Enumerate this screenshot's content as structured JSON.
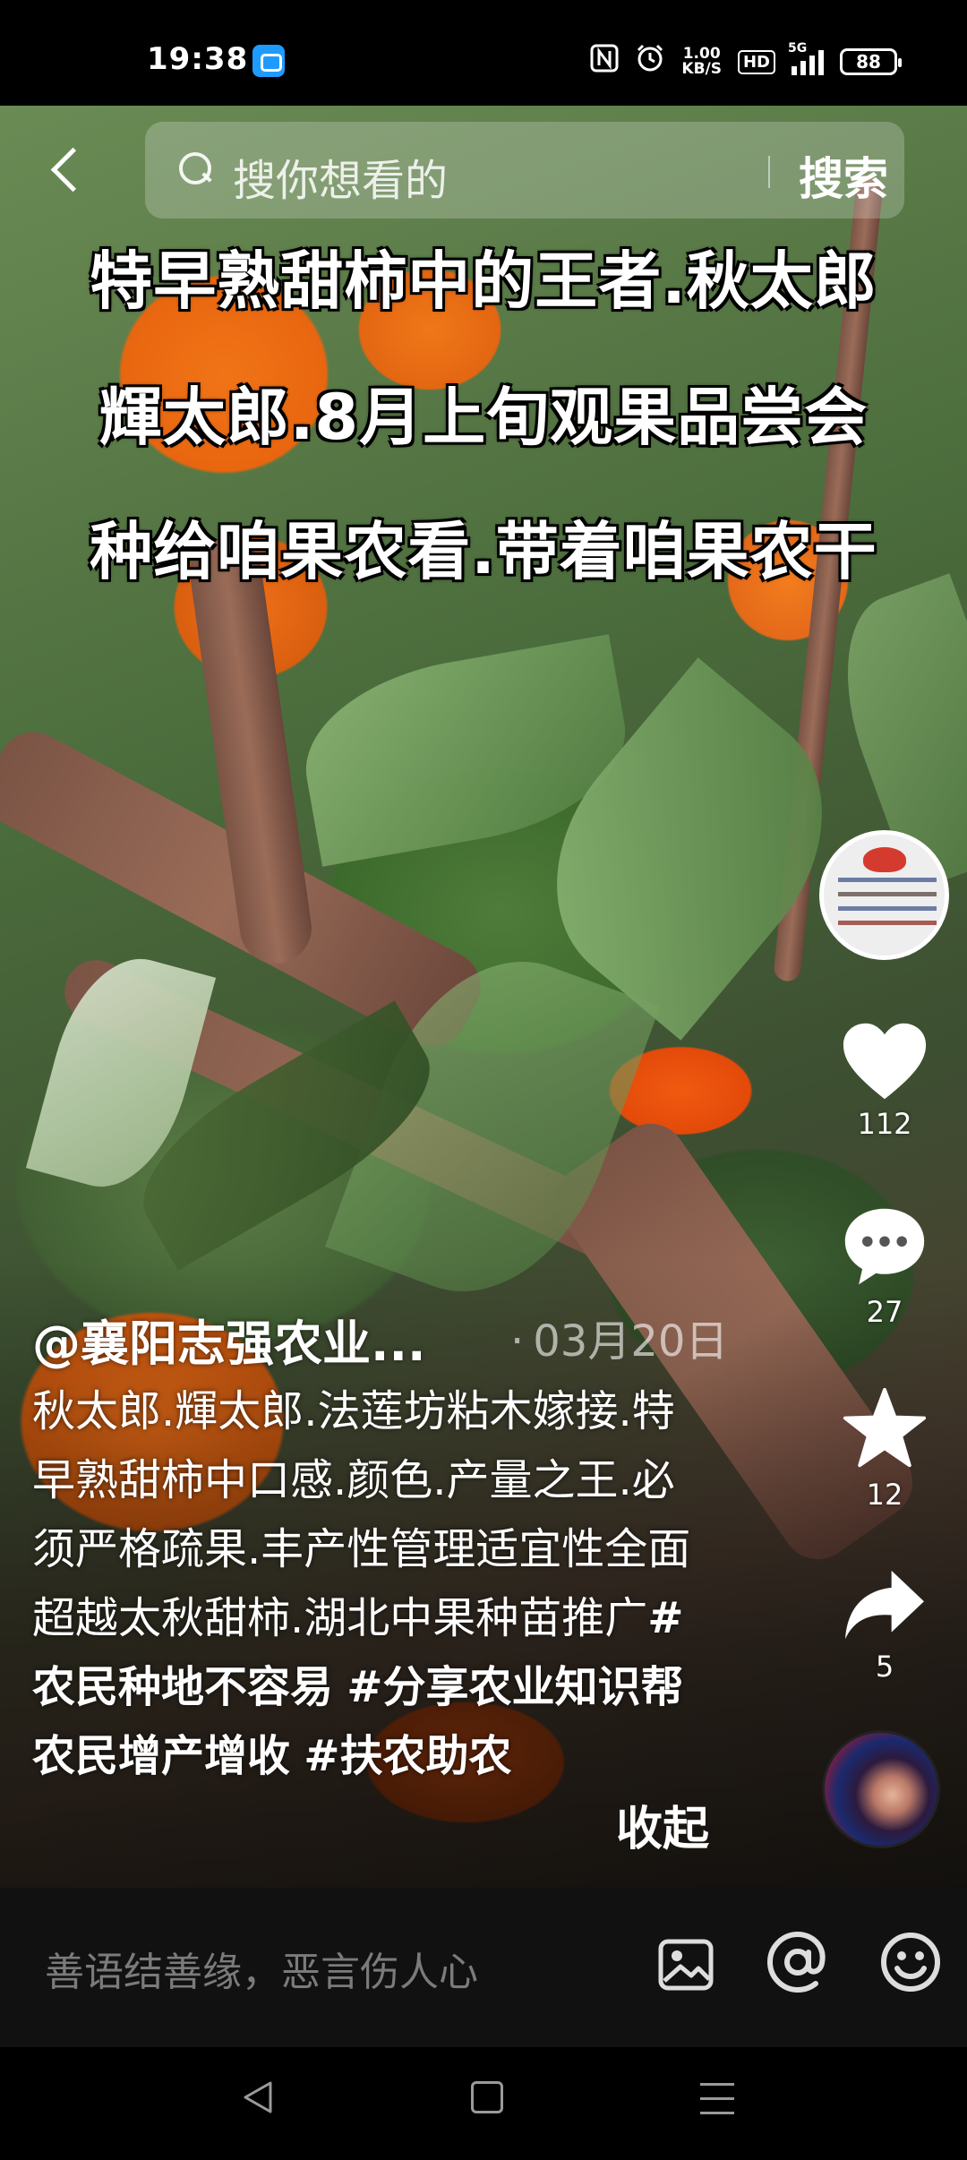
{
  "status_bar": {
    "time": "19:38",
    "speed_value": "1.00",
    "speed_unit": "KB/S",
    "hd": "HD",
    "network": "5G",
    "battery": "88",
    "icons": [
      "nfc-icon",
      "alarm-icon",
      "signal-icon",
      "battery-icon"
    ]
  },
  "top_nav": {
    "search_placeholder": "搜你想看的",
    "search_button": "搜索"
  },
  "video_overlay": {
    "lines": [
      "特早熟甜柿中的王者.秋太郎",
      "輝太郎.8月上旬观果品尝会",
      "种给咱果农看.带着咱果农干"
    ]
  },
  "actions": {
    "likes": "112",
    "comments": "27",
    "favorites": "12",
    "shares": "5"
  },
  "post": {
    "author": "@襄阳志强农业...",
    "date": "03月20日",
    "description_text": "秋太郎.輝太郎.法莲坊粘木嫁接.特早熟甜柿中口感.颜色.产量之王.必须严格疏果.丰产性管理适宜性全面超越太秋甜柿.湖北中果种苗推广",
    "hashtags": [
      "#农民种地不容易",
      "#分享农业知识帮农民增产增收",
      "#扶农助农"
    ],
    "collapse_label": "收起"
  },
  "comment_bar": {
    "placeholder": "善语结善缘，恶言伤人心"
  },
  "colors": {
    "status_bar_bg": "#000000",
    "comment_bar_bg": "#111111",
    "persimmon_orange": "#e8660f",
    "app_icon_blue": "#1e9bff"
  }
}
